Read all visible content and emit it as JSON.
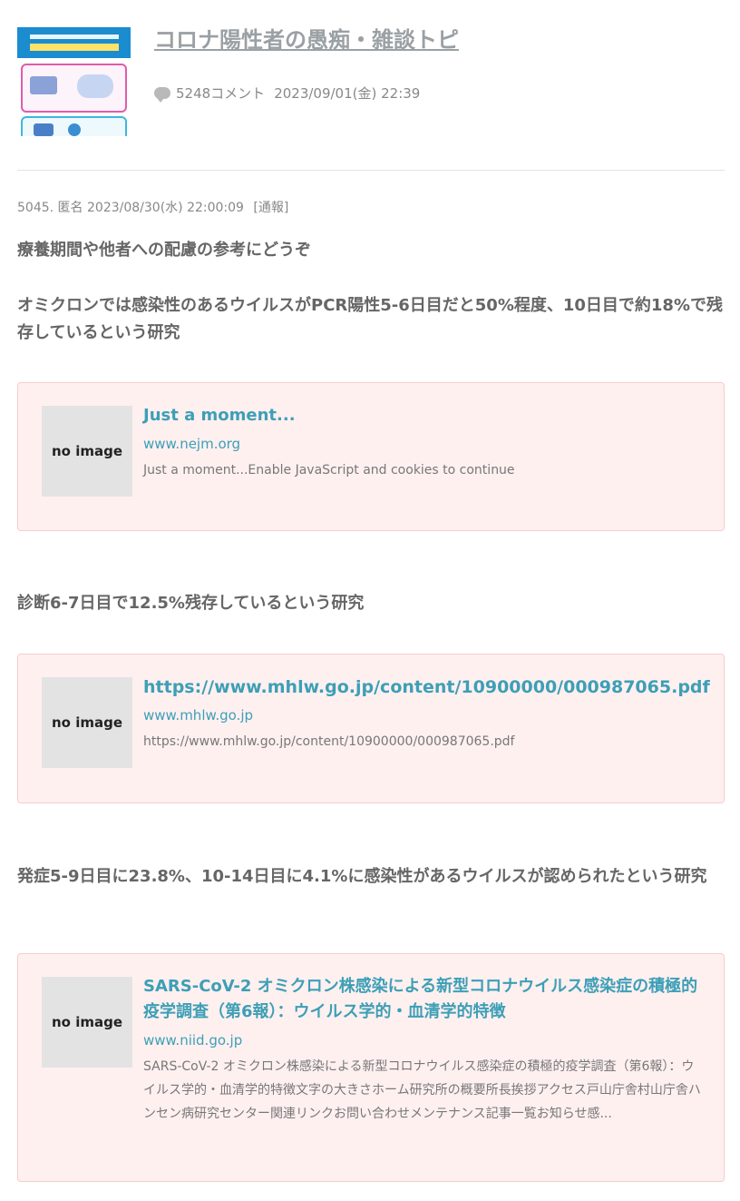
{
  "topic": {
    "title": "コロナ陽性者の愚痴・雑談トピ",
    "comment_count": "5248コメント",
    "date": "2023/09/01(金) 22:39",
    "icons": {
      "thumbnail": "mask-poster-thumbnail",
      "comment": "speech-bubble-icon"
    }
  },
  "comment": {
    "number": "5045.",
    "author": "匿名",
    "datetime": "2023/08/30(水) 22:00:09",
    "report_label": "[通報]",
    "paragraphs": [
      "療養期間や他者への配慮の参考にどうぞ",
      "オミクロンでは感染性のあるウイルスがPCR陽性5-6日目だと50%程度、10日目で約18%で残存しているという研究",
      "診断6-7日目で12.5%残存しているという研究",
      "発症5-9日目に23.8%、10-14日目に4.1%に感染性があるウイルスが認められたという研究"
    ],
    "link_cards": [
      {
        "image_label": "no image",
        "title": "Just a moment...",
        "domain": "www.nejm.org",
        "description": "Just a moment...Enable JavaScript and cookies to continue"
      },
      {
        "image_label": "no image",
        "title": "https://www.mhlw.go.jp/content/10900000/000987065.pdf",
        "domain": "www.mhlw.go.jp",
        "description": "https://www.mhlw.go.jp/content/10900000/000987065.pdf"
      },
      {
        "image_label": "no image",
        "title": "SARS-CoV-2 オミクロン株感染による新型コロナウイルス感染症の積極的疫学調査（第6報）：ウイルス学的・血清学的特徴",
        "domain": "www.niid.go.jp",
        "description": "SARS-CoV-2 オミクロン株感染による新型コロナウイルス感染症の積極的疫学調査（第6報）：ウイルス学的・血清学的特徴文字の大きさホーム研究所の概要所長挨拶アクセス戸山庁舎村山庁舎ハンセン病研究センター関連リンクお問い合わせメンテナンス記事一覧お知らせ感..."
      }
    ]
  },
  "colors": {
    "link": "#3d9fb6",
    "card_bg": "#fff0f0",
    "card_border": "#f7cccc",
    "title": "#9aa0a4"
  }
}
